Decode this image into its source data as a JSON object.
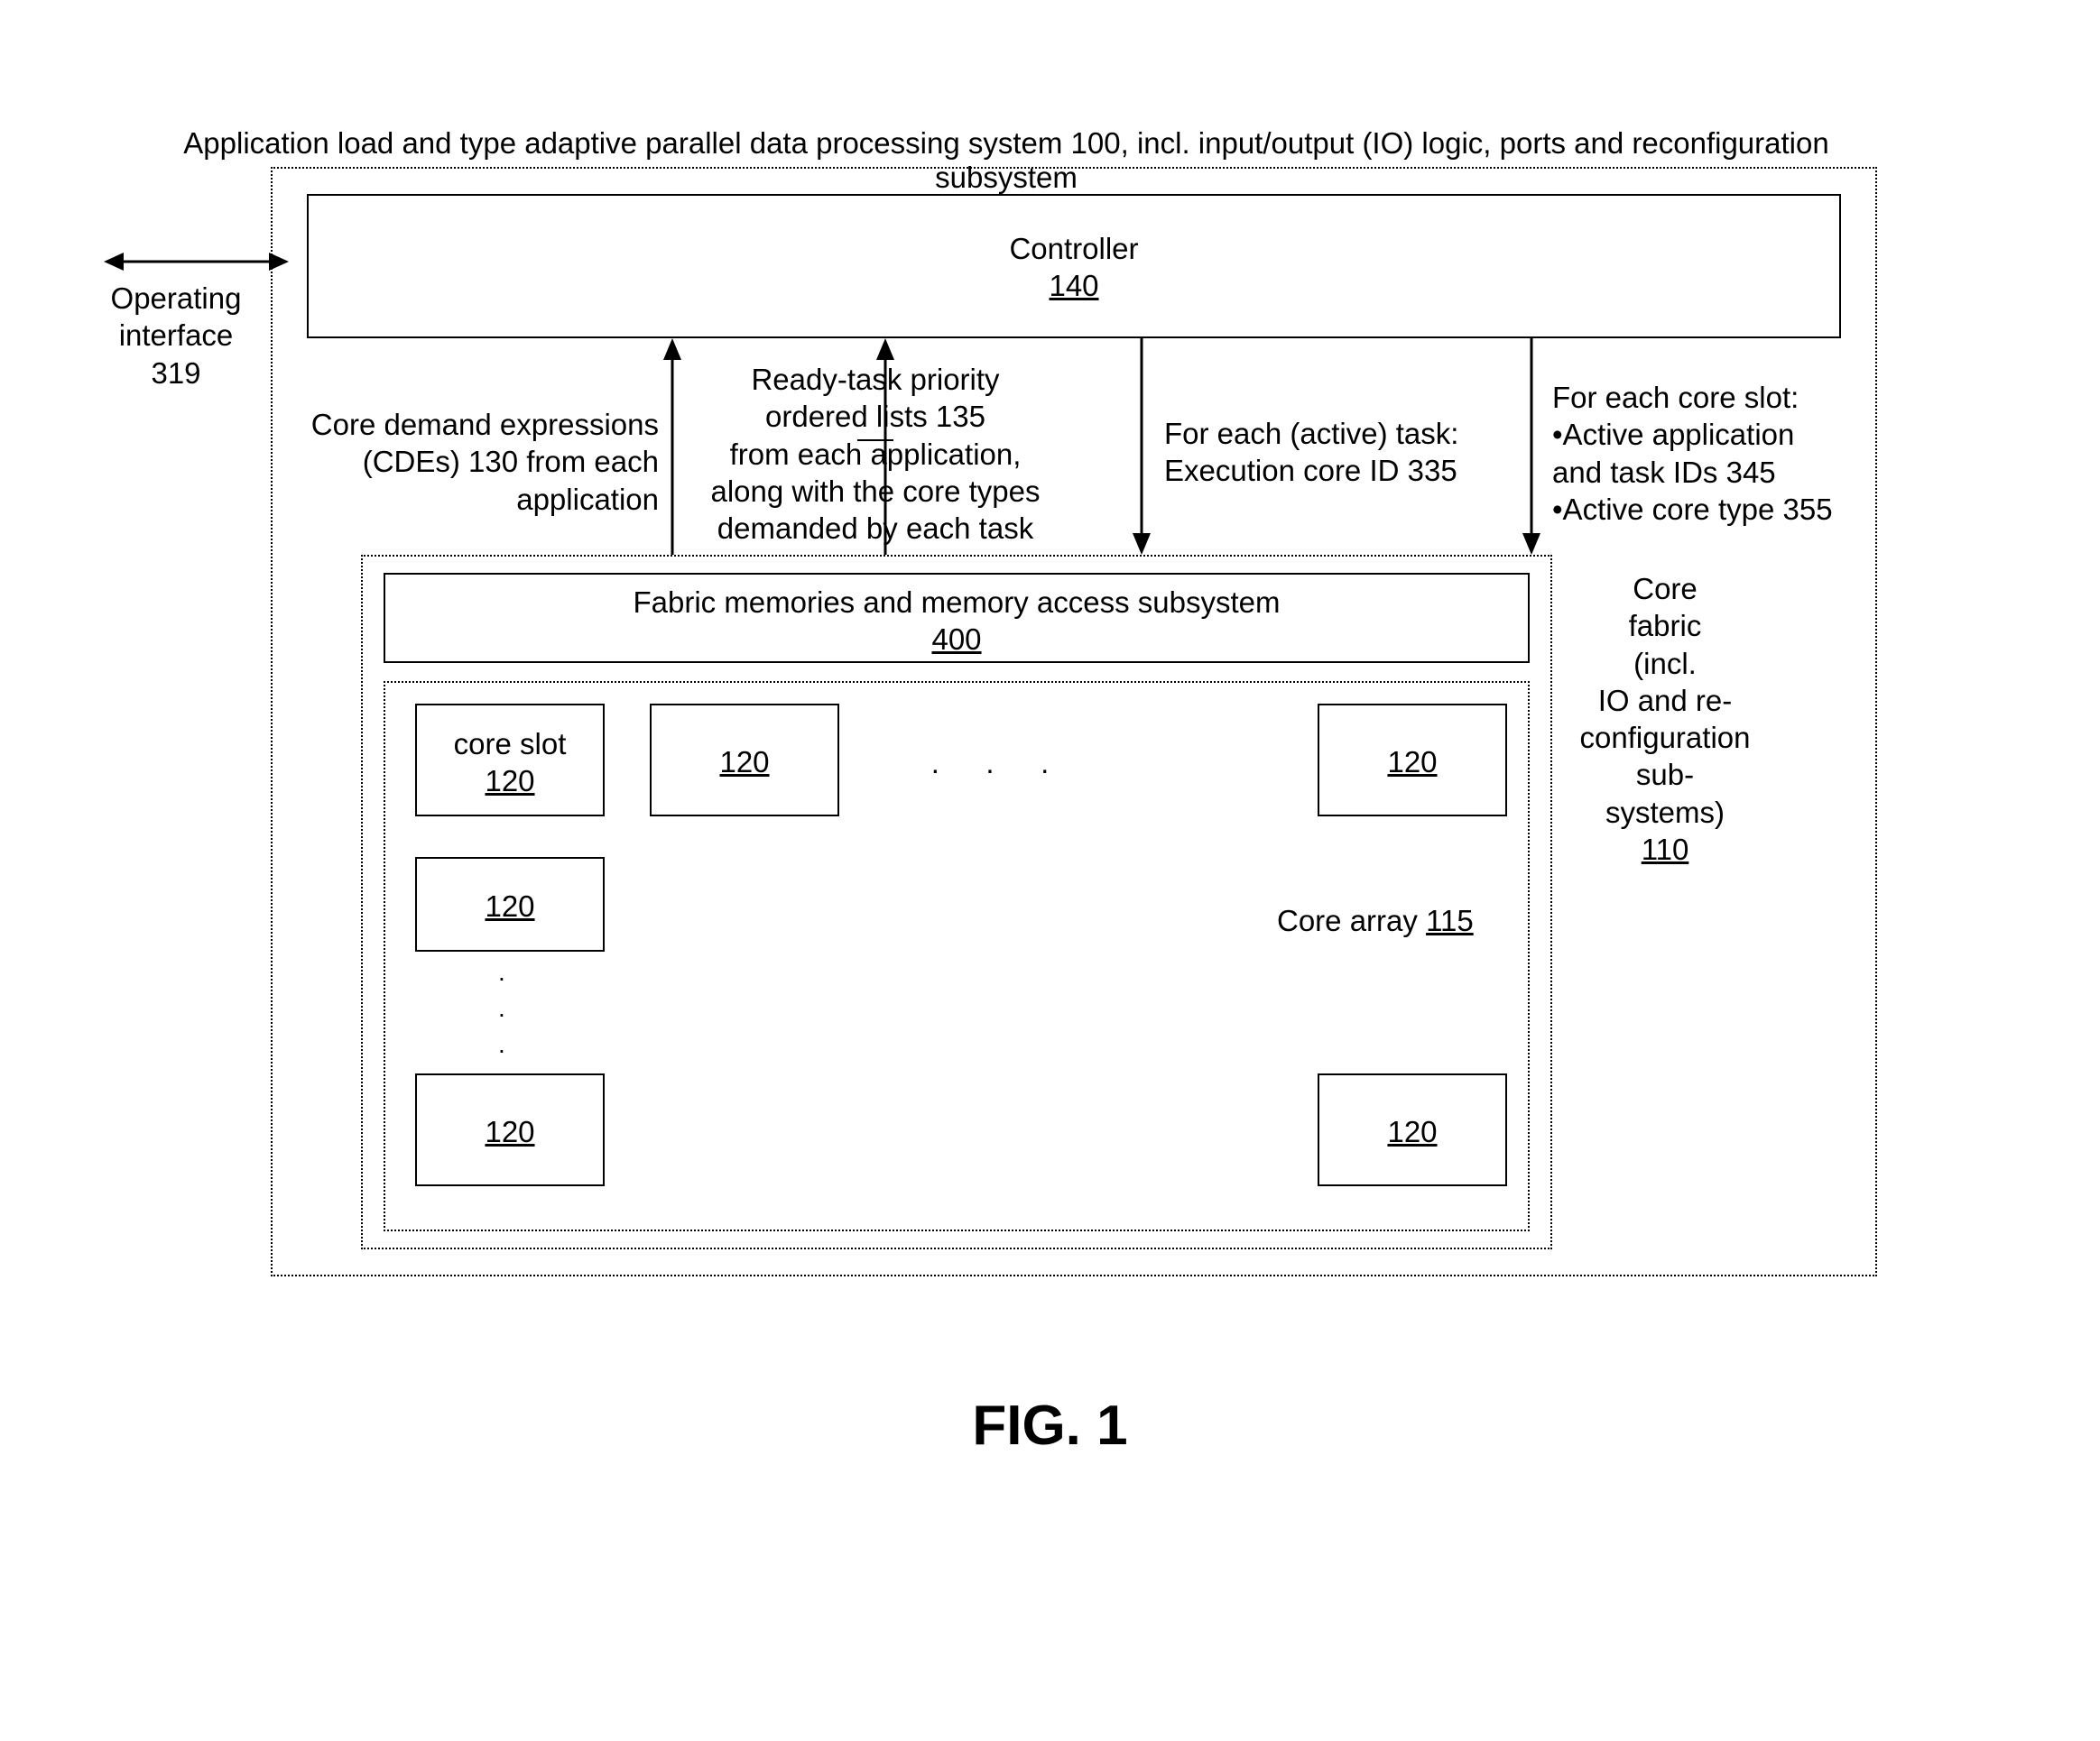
{
  "title": "Application load and type adaptive parallel data processing system 100, incl. input/output (IO) logic, ports and reconfiguration subsystem",
  "controller": {
    "name": "Controller",
    "ref": "140"
  },
  "operating_interface": {
    "line1": "Operating",
    "line2": "interface",
    "line3": "319"
  },
  "arrows": {
    "cde": {
      "line1": "Core demand expressions",
      "line2": "(CDEs) 130 from each",
      "line3": "application"
    },
    "ready": {
      "line1": "Ready-task priority",
      "line2": "ordered lists 135",
      "line3": "from each application,",
      "line4": "along with the core types",
      "line5": "demanded by each task"
    },
    "active_task": {
      "line1": "For each (active) task:",
      "line2": "Execution core ID 335"
    },
    "core_slot": {
      "line1": "For each core slot:",
      "bullet1": "•Active application",
      "line2": "and task IDs 345",
      "bullet2": "•Active core type 355"
    }
  },
  "fabric_mem": {
    "name": "Fabric memories and memory access subsystem",
    "ref": "400"
  },
  "core_fabric_label": {
    "line1": "Core",
    "line2": "fabric",
    "line3": "(incl.",
    "line4": "IO and re-",
    "line5": "configuration",
    "line6": "sub-",
    "line7": "systems)",
    "ref": "110"
  },
  "core_array_label": {
    "text": "Core array ",
    "ref": "115"
  },
  "core_slot": {
    "name": "core slot",
    "ref": "120"
  },
  "slot_ref": "120",
  "ellipsis_h": ".   .   .",
  "ellipsis_v": ".",
  "fig_caption": "FIG. 1"
}
